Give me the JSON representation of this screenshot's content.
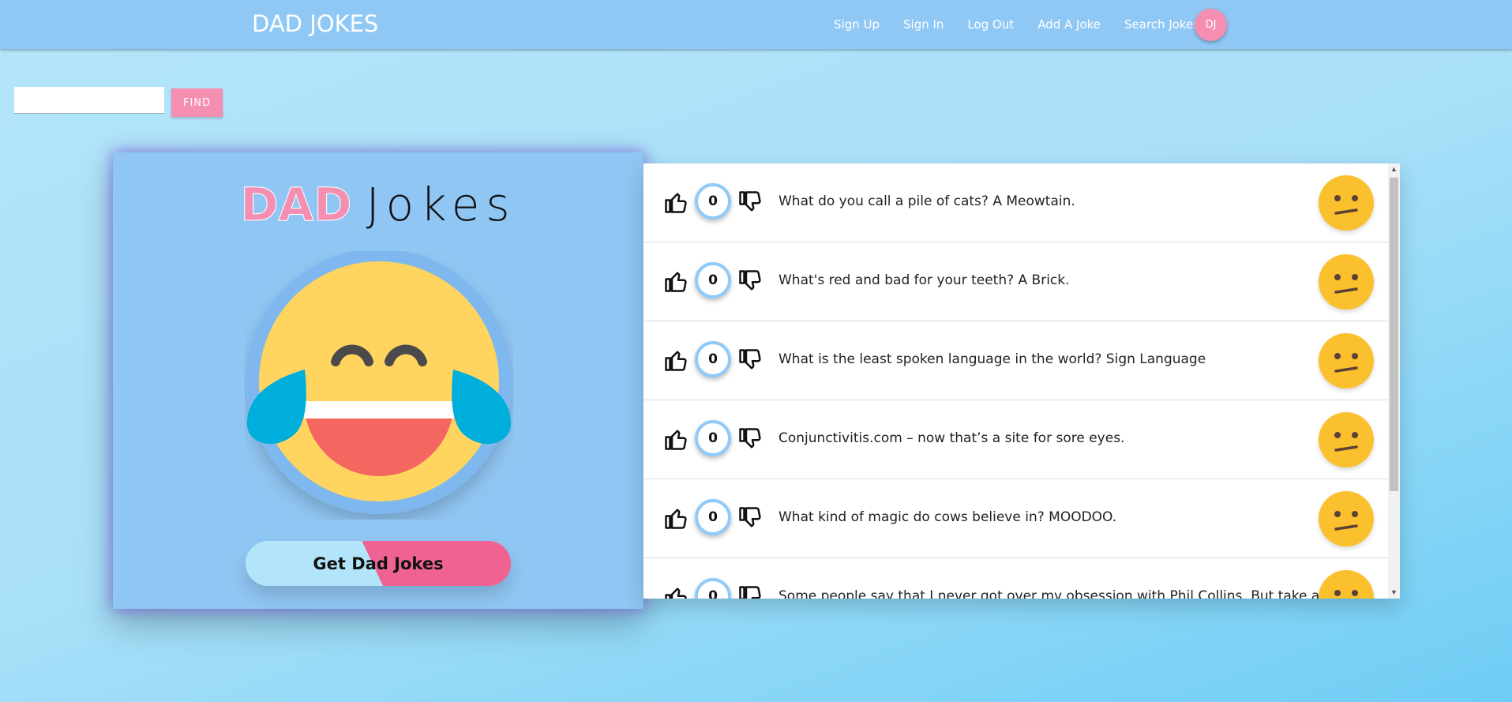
{
  "navbar": {
    "brand": "DAD JOKES",
    "links": [
      "Sign Up",
      "Sign In",
      "Log Out",
      "Add A Joke",
      "Search Jokes"
    ],
    "avatar_initials": "DJ"
  },
  "search": {
    "value": "",
    "button_label": "FIND"
  },
  "hero": {
    "title_dad": "DAD",
    "title_jokes": "Jokes",
    "get_button_label": "Get Dad Jokes"
  },
  "jokes": [
    {
      "votes": "0",
      "text": "What do you call a pile of cats? A Meowtain."
    },
    {
      "votes": "0",
      "text": "What's red and bad for your teeth? A Brick."
    },
    {
      "votes": "0",
      "text": "What is the least spoken language in the world? Sign Language"
    },
    {
      "votes": "0",
      "text": "Conjunctivitis.com – now that’s a site for sore eyes."
    },
    {
      "votes": "0",
      "text": "What kind of magic do cows believe in? MOODOO."
    },
    {
      "votes": "0",
      "text": "Some people say that I never got over my obsession with Phil Collins. But take a look"
    }
  ],
  "colors": {
    "navbar": "#90c8f5",
    "accent_pink": "#f48fb1",
    "vote_ring": "#90caf9",
    "face_yellow": "#fbc02d"
  },
  "icons": {
    "thumb_up": "thumbs-up-icon",
    "thumb_down": "thumbs-down-icon",
    "reaction": "confused-face-icon",
    "hero": "laughing-tears-emoji"
  }
}
